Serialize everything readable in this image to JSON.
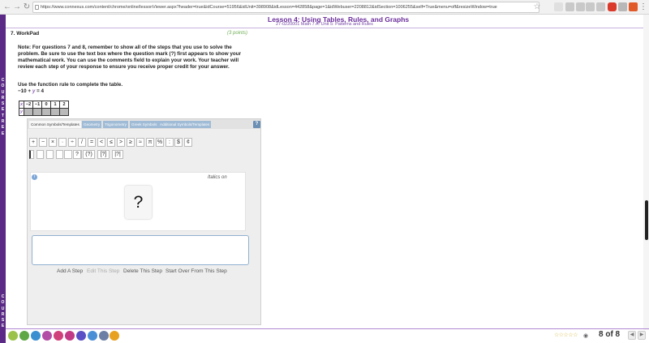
{
  "browser": {
    "url": "https://www.connexus.com/content/chrome/online/lessonViewer.aspx?header=true&idCourse=51956&idUnit=398908&idLesson=442858&page=1&idWebuser=2208812&idSection=1006255&self=True&menu=off&resizeWindow=true",
    "back_icon": "back-arrow-icon",
    "forward_icon": "forward-arrow-icon",
    "reload_icon": "reload-icon",
    "star_icon": "bookmark-star-icon"
  },
  "lesson": {
    "title": "Lesson 4: Using Tables, Rules, and Graphs",
    "subtitle": "27-0220001 Math 7 A: Unit 5: Patterns and Rules"
  },
  "sidebar": {
    "top_text": "C O U R S E   T R E E",
    "bottom_text": "C O U R S E"
  },
  "question": {
    "number": "7.  WorkPad",
    "points": "(3 points)",
    "note": "Note: For questions 7 and 8, remember to show all of the steps that you use to solve the problem. Be sure to use the text box where the question mark (?) first appears to show your mathematical work. You can use the comments field to explain your work. Your teacher will review each step of your response to ensure you receive proper credit for your answer.",
    "direction": "Use the function rule to complete the table.",
    "rule_prefix": "−10 + ",
    "rule_var": "y",
    "rule_suffix": " = 4"
  },
  "fn_table": {
    "x_label": "x",
    "y_label": "y",
    "x_values": [
      "−2",
      "−1",
      "0",
      "1",
      "2"
    ]
  },
  "editor": {
    "tabs": [
      "Common Symbols/Templates",
      "Geometry",
      "Trigonometry",
      "Greek Symbols",
      "Additional Symbols/Templates"
    ],
    "help": "?",
    "symbols_row1": [
      "+",
      "−",
      "×",
      "·",
      "÷",
      "/",
      "=",
      "<",
      "≤",
      ">",
      "≥",
      "≈",
      "π",
      "%",
      ":",
      "$",
      "¢"
    ],
    "templates_row2": [
      "?",
      "(?)",
      "[?]",
      "|?|"
    ],
    "italics": "Italics on",
    "canvas_placeholder": "?",
    "info": "i"
  },
  "actions": {
    "add_step": "Add A Step",
    "edit_step": "Edit This Step",
    "delete_step": "Delete This Step",
    "start_over": "Start Over From This Step"
  },
  "footer": {
    "stars": "☆☆☆☆☆",
    "page_count": "8 of 8",
    "prev": "◀",
    "next": "▶"
  },
  "colors": {
    "sidebar": "#5b2a86",
    "title": "#6a2c9a",
    "points": "#6fae55",
    "tab_inactive": "#9fbbd6"
  }
}
